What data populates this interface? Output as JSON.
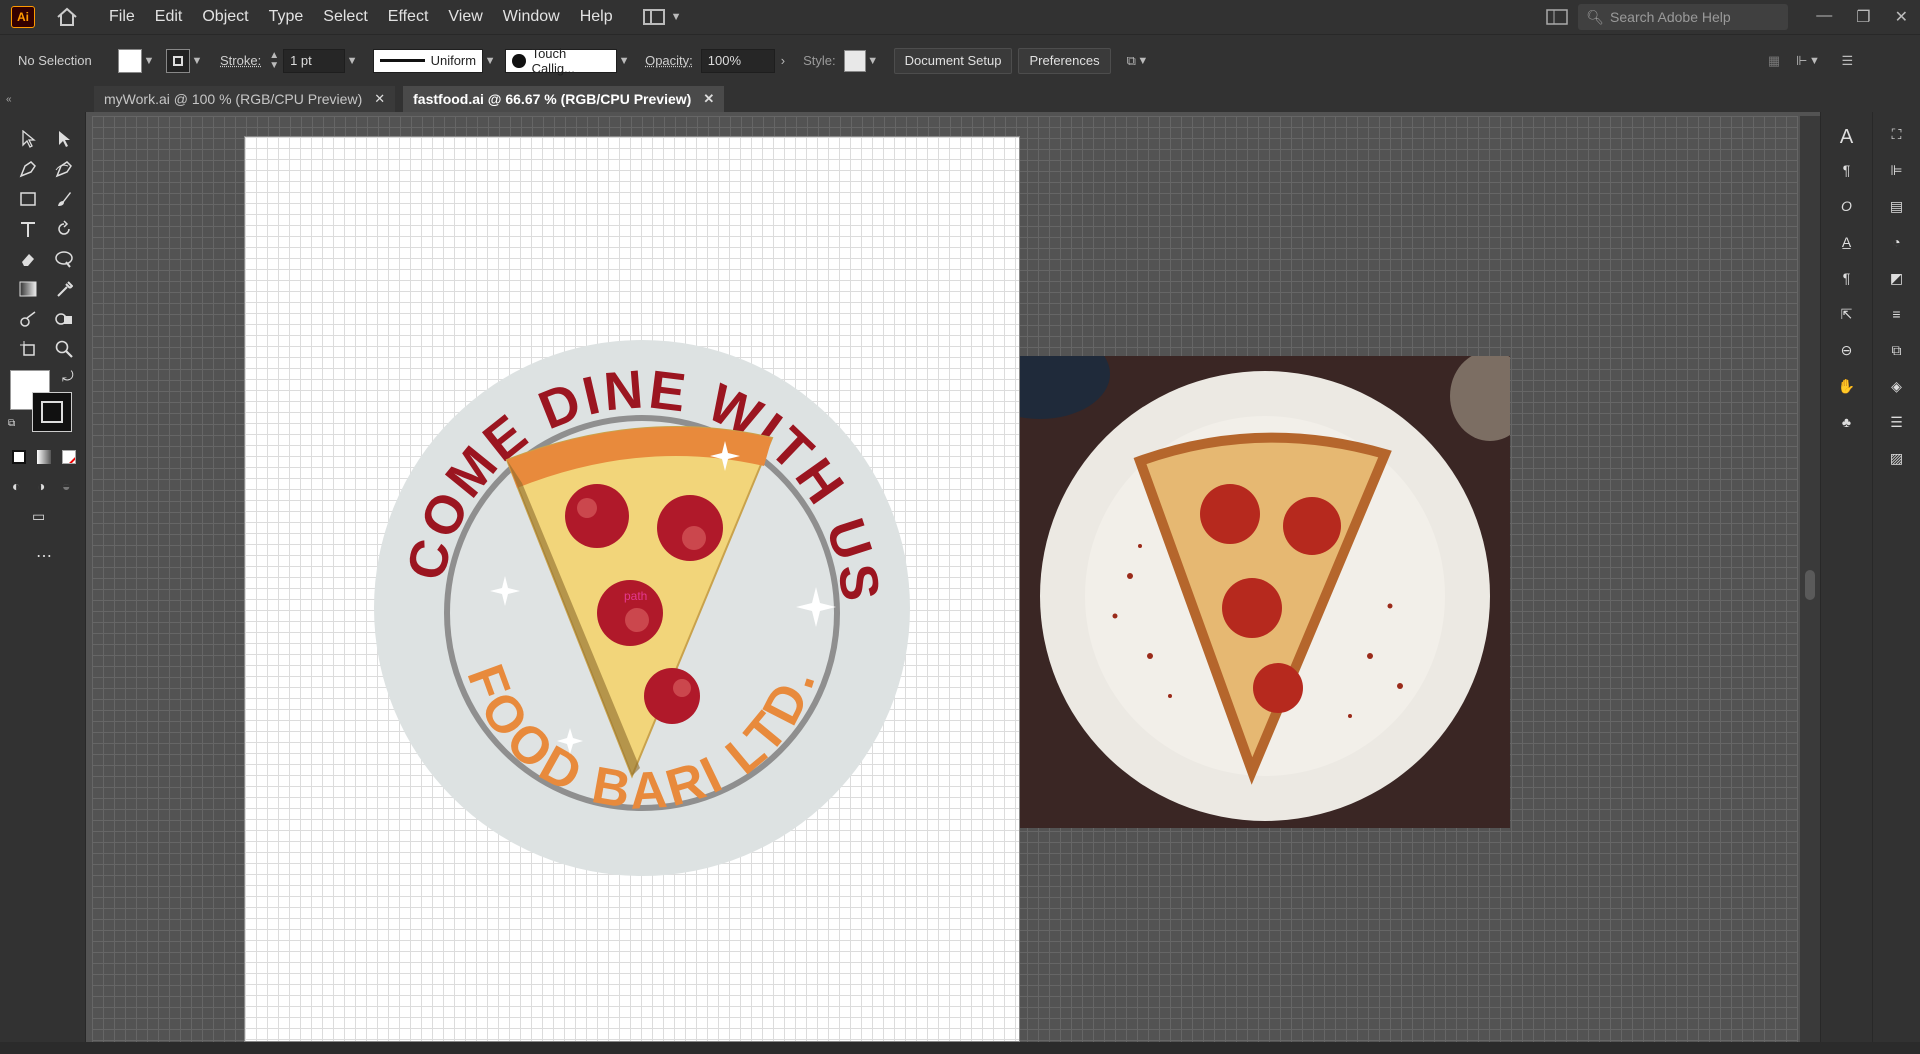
{
  "app": {
    "logo": "Ai"
  },
  "menu": [
    "File",
    "Edit",
    "Object",
    "Type",
    "Select",
    "Effect",
    "View",
    "Window",
    "Help"
  ],
  "search": {
    "placeholder": "Search Adobe Help"
  },
  "control": {
    "selection": "No Selection",
    "stroke_label": "Stroke:",
    "stroke_value": "1 pt",
    "profile": "Uniform",
    "brush": "Touch Callig...",
    "opacity_label": "Opacity:",
    "opacity_value": "100%",
    "style_label": "Style:",
    "doc_setup": "Document Setup",
    "preferences": "Preferences"
  },
  "tabs": [
    {
      "label": "myWork.ai @ 100 % (RGB/CPU Preview)",
      "active": false
    },
    {
      "label": "fastfood.ai @ 66.67 % (RGB/CPU Preview)",
      "active": true
    }
  ],
  "logo_art": {
    "top_text": "COME DINE WITH US",
    "bottom_text": "FOOD BARI LTD.",
    "path_label": "path"
  },
  "colors": {
    "accent_red": "#9b1520",
    "accent_orange": "#e88a3c",
    "badge": "#dfe3e3",
    "ui_dark": "#323232"
  }
}
